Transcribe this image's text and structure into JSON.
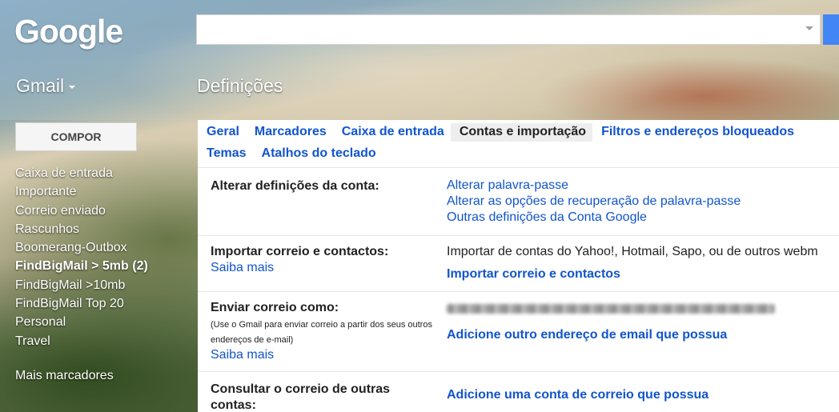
{
  "header": {
    "logo": "Google",
    "search_value": "",
    "app_name": "Gmail",
    "page_title": "Definições"
  },
  "compose_label": "COMPOR",
  "nav": {
    "items": [
      {
        "label": "Caixa de entrada",
        "bold": false
      },
      {
        "label": "Importante",
        "bold": false
      },
      {
        "label": "Correio enviado",
        "bold": false
      },
      {
        "label": "Rascunhos",
        "bold": false
      },
      {
        "label": "Boomerang-Outbox",
        "bold": false
      },
      {
        "label": "FindBigMail > 5mb (2)",
        "bold": true
      },
      {
        "label": "FindBigMail >10mb",
        "bold": false
      },
      {
        "label": "FindBigMail Top 20",
        "bold": false
      },
      {
        "label": "Personal",
        "bold": false
      },
      {
        "label": "Travel",
        "bold": false
      }
    ],
    "more": "Mais marcadores"
  },
  "tabs": {
    "row1": [
      "Geral",
      "Marcadores",
      "Caixa de entrada",
      "Contas e importação",
      "Filtros e endereços bloqueados"
    ],
    "row2": [
      "Temas",
      "Atalhos do teclado"
    ],
    "active": "Contas e importação"
  },
  "settings": {
    "account": {
      "label": "Alterar definições da conta:",
      "links": [
        "Alterar palavra-passe",
        "Alterar as opções de recuperação de palavra-passe",
        "Outras definições da Conta Google"
      ]
    },
    "import": {
      "label": "Importar correio e contactos:",
      "learn_more": "Saiba mais",
      "description": "Importar de contas do Yahoo!, Hotmail, Sapo, ou de outros webm",
      "action": "Importar correio e contactos"
    },
    "send_as": {
      "label": "Enviar correio como:",
      "note": "(Use o Gmail para enviar correio a partir dos seus outros endereços de e-mail)",
      "learn_more": "Saiba mais",
      "action": "Adicione outro endereço de email que possua"
    },
    "check_mail": {
      "label": "Consultar o correio de outras contas:",
      "action": "Adicione uma conta de correio que possua"
    }
  },
  "colors": {
    "link": "#1155cc",
    "search_button": "#4285f4",
    "active_tab_bg": "#eeeeee"
  }
}
